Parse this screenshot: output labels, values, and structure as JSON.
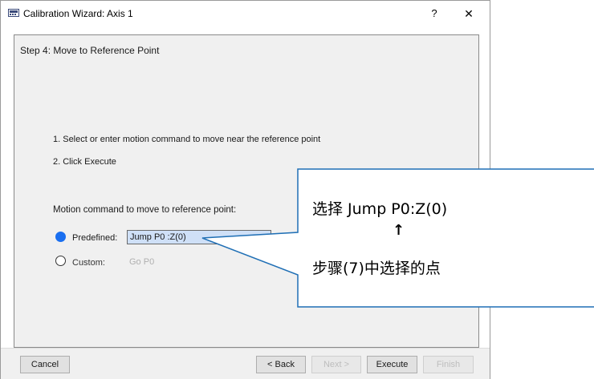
{
  "window": {
    "title": "Calibration Wizard: Axis 1",
    "help_label": "?",
    "close_label": "✕"
  },
  "step": {
    "title": "Step 4: Move to Reference Point",
    "instruction_1": "1. Select or enter motion command to move near the reference point",
    "instruction_2": "2. Click Execute",
    "motion_label": "Motion command to move to reference point:"
  },
  "options": {
    "predefined": {
      "label": "Predefined:",
      "selected": true,
      "value": "Jump P0 :Z(0)"
    },
    "custom": {
      "label": "Custom:",
      "selected": false,
      "value": "Go P0"
    }
  },
  "footer": {
    "cancel": "Cancel",
    "back": "< Back",
    "next": "Next >",
    "execute": "Execute",
    "finish": "Finish"
  },
  "callout": {
    "line1": "选择 Jump P0:Z(0)",
    "arrow": "↑",
    "line2": "步骤(7)中选择的点",
    "border_color": "#1f6fb5"
  },
  "colors": {
    "accent": "#1a6ff0",
    "select_bg": "#cfe0f7",
    "panel_bg": "#f0f0f0"
  },
  "icons": {
    "app": "calibration-icon",
    "dropdown": "chevron-down-icon"
  }
}
